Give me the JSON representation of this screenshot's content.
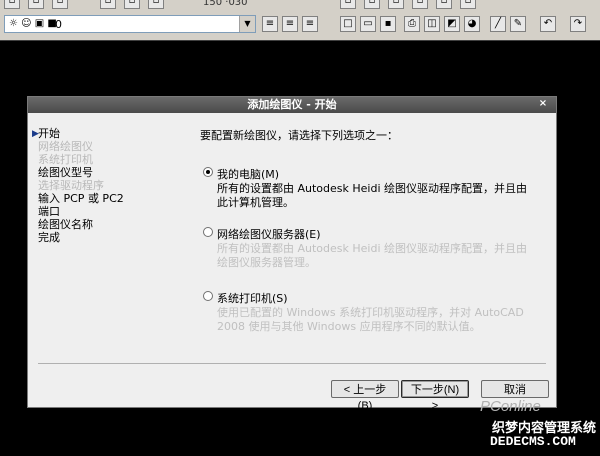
{
  "toolbar": {
    "coordinate_readout": "150 ·030",
    "layer_value": "0"
  },
  "dialog": {
    "title": "添加绘图仪 - 开始",
    "close_glyph": "×",
    "steps": [
      {
        "label": "开始",
        "state": "current"
      },
      {
        "label": "网络绘图仪",
        "state": "disabled"
      },
      {
        "label": "系统打印机",
        "state": "disabled"
      },
      {
        "label": "绘图仪型号",
        "state": "enabled"
      },
      {
        "label": "选择驱动程序",
        "state": "disabled"
      },
      {
        "label": "输入 PCP 或 PC2",
        "state": "enabled"
      },
      {
        "label": "端口",
        "state": "enabled"
      },
      {
        "label": "绘图仪名称",
        "state": "enabled"
      },
      {
        "label": "完成",
        "state": "enabled"
      }
    ],
    "prompt": "要配置新绘图仪，请选择下列选项之一：",
    "options": [
      {
        "label": "我的电脑(M)",
        "checked": true,
        "desc": "所有的设置都由 Autodesk Heidi 绘图仪驱动程序配置，并且由此计算机管理。",
        "desc_disabled": false
      },
      {
        "label": "网络绘图仪服务器(E)",
        "checked": false,
        "desc": "所有的设置都由 Autodesk Heidi 绘图仪驱动程序配置，并且由绘图仪服务器管理。",
        "desc_disabled": true
      },
      {
        "label": "系统打印机(S)",
        "checked": false,
        "desc": "使用已配置的 Windows 系统打印机驱动程序，并对 AutoCAD 2008 使用与其他 Windows 应用程序不同的默认值。",
        "desc_disabled": true
      }
    ],
    "buttons": {
      "back": "< 上一步(B)",
      "next": "下一步(N) >",
      "cancel": "取消"
    }
  },
  "watermark": {
    "brand": "PConline",
    "site_name": "织梦内容管理系统",
    "domain": "DEDECMS.COM"
  }
}
